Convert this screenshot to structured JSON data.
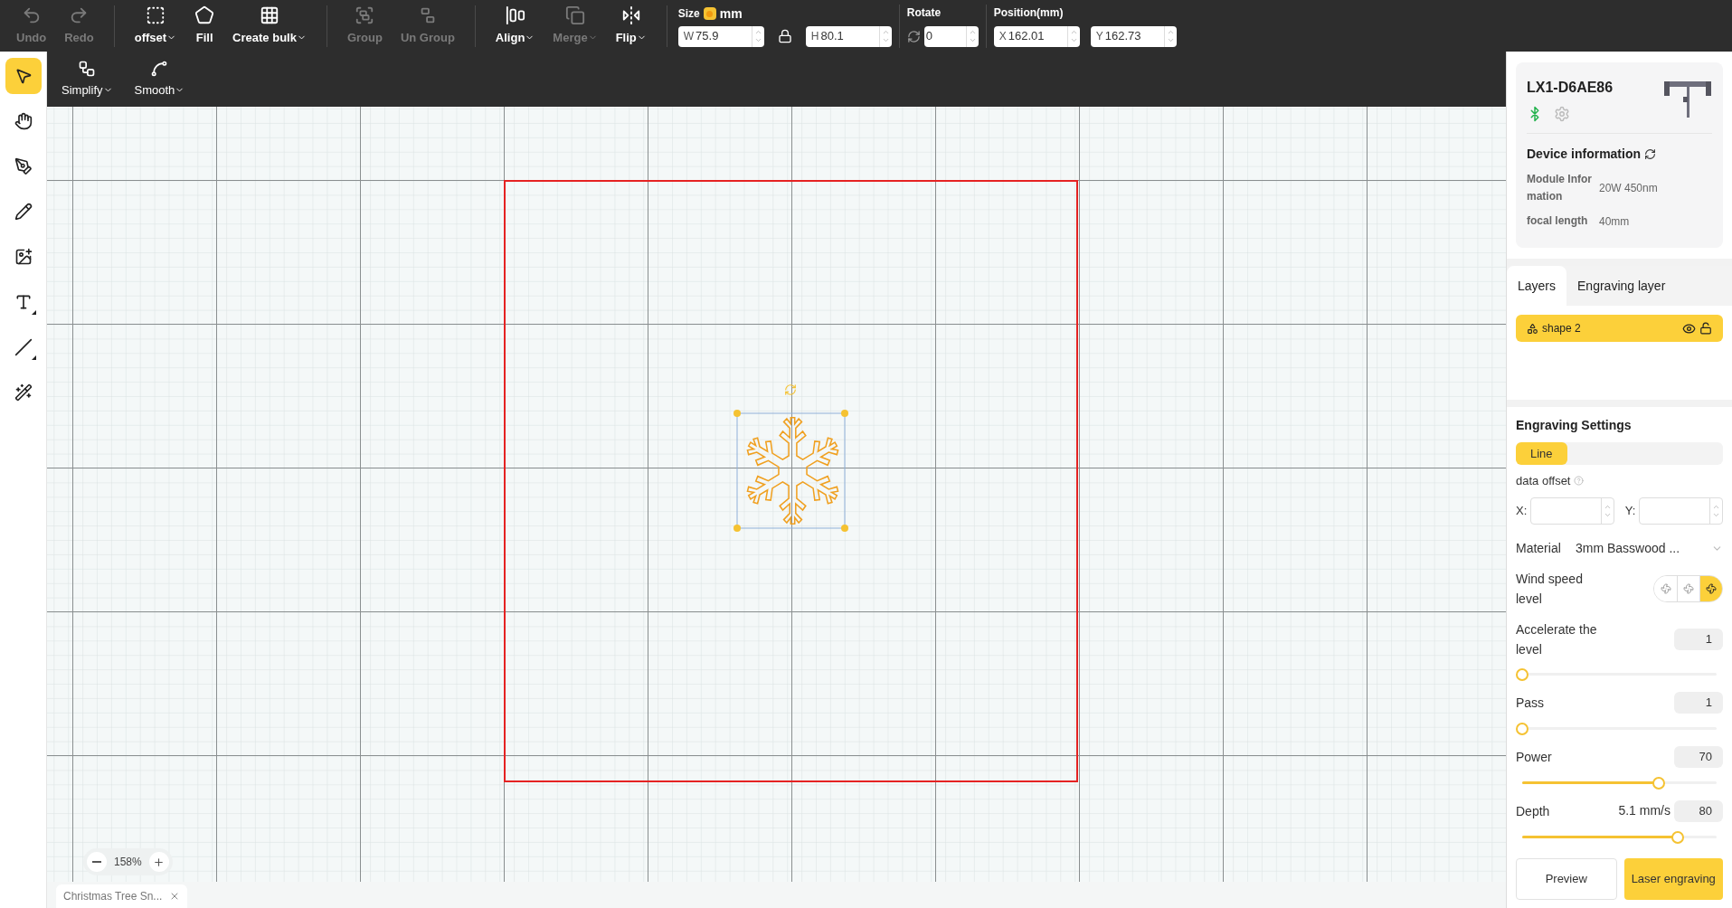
{
  "toolbar": {
    "tool_groups": [
      [
        {
          "label": "Undo",
          "disabled": true,
          "dropdown": false
        },
        {
          "label": "Redo",
          "disabled": true,
          "dropdown": false
        }
      ],
      [
        {
          "label": "offset",
          "disabled": false,
          "dropdown": true
        },
        {
          "label": "Fill",
          "disabled": false,
          "dropdown": false
        },
        {
          "label": "Create bulk",
          "disabled": false,
          "dropdown": true
        }
      ],
      [
        {
          "label": "Group",
          "disabled": true,
          "dropdown": false
        },
        {
          "label": "Un Group",
          "disabled": true,
          "dropdown": false
        }
      ],
      [
        {
          "label": "Align",
          "disabled": false,
          "dropdown": true
        },
        {
          "label": "Merge",
          "disabled": true,
          "dropdown": true
        },
        {
          "label": "Flip",
          "disabled": false,
          "dropdown": true
        }
      ]
    ],
    "size": {
      "label": "Size",
      "unit": "mm",
      "unit_on": true,
      "width": {
        "prefix": "W",
        "value": "75.9"
      },
      "locked": true,
      "height": {
        "prefix": "H",
        "value": "80.1"
      }
    },
    "rotate": {
      "label": "Rotate",
      "value": "0"
    },
    "position": {
      "label": "Position(mm)",
      "x": {
        "prefix": "X",
        "value": "162.01"
      },
      "y": {
        "prefix": "Y",
        "value": "162.73"
      }
    }
  },
  "secondary_toolbar": [
    {
      "label": "Simplify",
      "dropdown": true
    },
    {
      "label": "Smooth",
      "dropdown": true
    }
  ],
  "left_tools": [
    {
      "selected": true,
      "corner": false
    },
    {
      "selected": false,
      "corner": false
    },
    {
      "selected": false,
      "corner": false
    },
    {
      "selected": false,
      "corner": false
    },
    {
      "selected": false,
      "corner": false
    },
    {
      "selected": false,
      "corner": true
    },
    {
      "selected": false,
      "corner": true
    },
    {
      "selected": false,
      "corner": false
    }
  ],
  "canvas": {
    "zoom": "158%",
    "file_tab": "Christmas Tree Sn..."
  },
  "device": {
    "name": "LX1-D6AE86",
    "connected": true,
    "info_title": "Device information",
    "info": [
      {
        "label": "Module Information",
        "value": "20W 450nm"
      },
      {
        "label": "focal length",
        "value": "40mm"
      }
    ]
  },
  "layer_tabs": [
    {
      "label": "Layers",
      "selected": true
    },
    {
      "label": "Engraving layer",
      "selected": false
    }
  ],
  "layers": [
    {
      "name": "shape 2",
      "selected": true,
      "visible": true,
      "locked": false
    }
  ],
  "engraving": {
    "title": "Engraving Settings",
    "modes": [
      {
        "label": "Line",
        "selected": true
      }
    ],
    "data_offset": "data offset",
    "offset_x": "X:",
    "offset_y": "Y:",
    "material_label": "Material",
    "material": "3mm Basswood ...",
    "wind_label": "Wind speed level",
    "wind_levels": [
      {
        "selected": false
      },
      {
        "selected": false
      },
      {
        "selected": true
      }
    ],
    "sliders": [
      {
        "label": "Accelerate the level",
        "value": "1",
        "level": 0
      },
      {
        "label": "Pass",
        "value": "1",
        "level": 0
      },
      {
        "label": "Power",
        "value": "70",
        "level": 0.7
      },
      {
        "label": "Depth",
        "reading": "5.1 mm/s",
        "value": "80",
        "level": 0.8
      }
    ],
    "buttons": [
      {
        "label": "Preview",
        "primary": false
      },
      {
        "label": "Laser engraving",
        "primary": true
      }
    ]
  }
}
